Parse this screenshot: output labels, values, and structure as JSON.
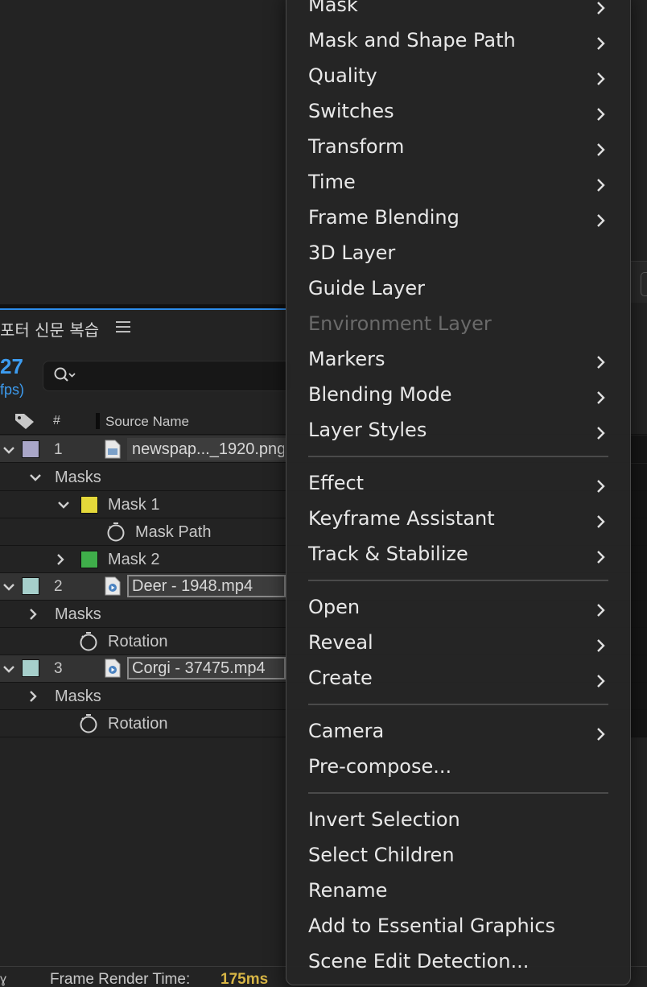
{
  "panel": {
    "title": "포터 신문 복습",
    "timecode": "27",
    "fps": "fps)",
    "search_placeholder": ""
  },
  "columns": {
    "hash": "#",
    "source_name": "Source Name"
  },
  "rows": [
    {
      "kind": "layer",
      "num": "1",
      "color": "#a9a6c8",
      "name": "newspap..._1920.png"
    },
    {
      "kind": "group",
      "label": "Masks"
    },
    {
      "kind": "mask",
      "label": "Mask 1",
      "color": "#e4d83a"
    },
    {
      "kind": "prop",
      "label": "Mask Path"
    },
    {
      "kind": "mask",
      "label": "Mask 2",
      "color": "#3fae4a"
    },
    {
      "kind": "layer",
      "num": "2",
      "color": "#a6cfcb",
      "name": "Deer - 1948.mp4"
    },
    {
      "kind": "group",
      "label": "Masks"
    },
    {
      "kind": "prop",
      "label": "Rotation"
    },
    {
      "kind": "layer",
      "num": "3",
      "color": "#a6cfcb",
      "name": "Corgi - 37475.mp4"
    },
    {
      "kind": "group",
      "label": "Masks"
    },
    {
      "kind": "prop",
      "label": "Rotation"
    }
  ],
  "status": {
    "frame_render_label": "Frame Render Time:",
    "frame_render_value": "175ms",
    "left_glyph": "ɣ"
  },
  "menu": {
    "items": [
      {
        "label": "Mask",
        "submenu": true
      },
      {
        "label": "Mask and Shape Path",
        "submenu": true
      },
      {
        "label": "Quality",
        "submenu": true
      },
      {
        "label": "Switches",
        "submenu": true
      },
      {
        "label": "Transform",
        "submenu": true
      },
      {
        "label": "Time",
        "submenu": true
      },
      {
        "label": "Frame Blending",
        "submenu": true
      },
      {
        "label": "3D Layer",
        "submenu": false
      },
      {
        "label": "Guide Layer",
        "submenu": false
      },
      {
        "label": "Environment Layer",
        "submenu": false,
        "disabled": true
      },
      {
        "label": "Markers",
        "submenu": true
      },
      {
        "label": "Blending Mode",
        "submenu": true
      },
      {
        "label": "Layer Styles",
        "submenu": true
      },
      {
        "label": "Effect",
        "submenu": true
      },
      {
        "label": "Keyframe Assistant",
        "submenu": true
      },
      {
        "label": "Track & Stabilize",
        "submenu": true
      },
      {
        "label": "Open",
        "submenu": true
      },
      {
        "label": "Reveal",
        "submenu": true
      },
      {
        "label": "Create",
        "submenu": true
      },
      {
        "label": "Camera",
        "submenu": true
      },
      {
        "label": "Pre-compose...",
        "submenu": false
      },
      {
        "label": "Invert Selection",
        "submenu": false
      },
      {
        "label": "Select Children",
        "submenu": false
      },
      {
        "label": "Rename",
        "submenu": false
      },
      {
        "label": "Add to Essential Graphics",
        "submenu": false
      },
      {
        "label": "Scene Edit Detection...",
        "submenu": false
      }
    ]
  }
}
